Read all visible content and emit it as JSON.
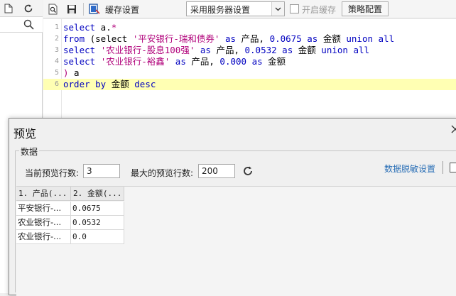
{
  "left_panel": {
    "toolbar_icons": [
      "page-icon",
      "refresh-icon"
    ],
    "search_icon": "search-icon"
  },
  "toolbar": {
    "icons": [
      "search-doc-icon",
      "save-icon",
      "cache-icon"
    ],
    "cache_label": "缓存设置",
    "cache_select_value": "采用服务器设置",
    "enable_cache_label": "开启缓存",
    "enable_cache_checked": false,
    "strategy_button": "策略配置"
  },
  "editor": {
    "lines": [
      {
        "num": "1",
        "tokens": [
          [
            "kw",
            "select"
          ],
          [
            "id",
            " a."
          ],
          [
            "str",
            "*"
          ]
        ]
      },
      {
        "num": "2",
        "tokens": [
          [
            "kw",
            "from"
          ],
          [
            "id",
            " (select "
          ],
          [
            "str",
            "'平安银行-瑞和债券'"
          ],
          [
            "kw",
            " as"
          ],
          [
            "id",
            " 产品, "
          ],
          [
            "num",
            "0.0675"
          ],
          [
            "kw",
            " as"
          ],
          [
            "id",
            " 金额 "
          ],
          [
            "kw",
            "union all"
          ]
        ]
      },
      {
        "num": "3",
        "tokens": [
          [
            "kw",
            "select"
          ],
          [
            "id",
            " "
          ],
          [
            "str",
            "'农业银行-股息100强'"
          ],
          [
            "kw",
            " as"
          ],
          [
            "id",
            " 产品, "
          ],
          [
            "num",
            "0.0532"
          ],
          [
            "kw",
            " as"
          ],
          [
            "id",
            " 金额 "
          ],
          [
            "kw",
            "union all"
          ]
        ]
      },
      {
        "num": "4",
        "tokens": [
          [
            "kw",
            "select"
          ],
          [
            "id",
            " "
          ],
          [
            "str",
            "'农业银行-裕鑫'"
          ],
          [
            "kw",
            " as"
          ],
          [
            "id",
            " 产品, "
          ],
          [
            "num",
            "0.000"
          ],
          [
            "kw",
            " as"
          ],
          [
            "id",
            " 金额"
          ]
        ]
      },
      {
        "num": "5",
        "tokens": [
          [
            "str",
            ")"
          ],
          [
            "id",
            " a"
          ]
        ]
      },
      {
        "num": "6",
        "tokens": [
          [
            "kw",
            "order by"
          ],
          [
            "id",
            " 金额 "
          ],
          [
            "kw",
            "desc"
          ]
        ]
      }
    ],
    "active_line": 6
  },
  "dialog": {
    "title": "预览",
    "close_icon": "close-icon",
    "group_label": "数据",
    "current_rows_label": "当前预览行数:",
    "current_rows_value": "3",
    "max_rows_label": "最大的预览行数:",
    "max_rows_value": "200",
    "refresh_icon": "refresh-icon",
    "mask_link": "数据脱敏设置",
    "grid": {
      "columns": [
        "1. 产品(...",
        "2. 金额(..."
      ],
      "rows": [
        [
          "平安银行-...",
          "0.0675"
        ],
        [
          "农业银行-...",
          "0.0532"
        ],
        [
          "农业银行-...",
          "0.0"
        ]
      ]
    }
  },
  "colors": {
    "keyword": "#0000c0",
    "string": "#b0007a",
    "active_line": "#ffffb3",
    "link": "#2a6fb6"
  }
}
